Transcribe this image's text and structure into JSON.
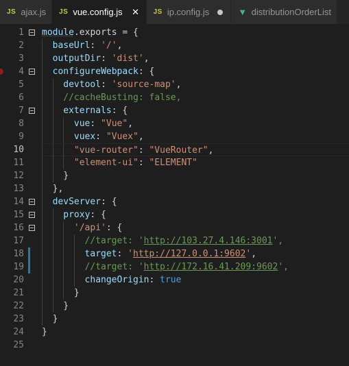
{
  "tabs": [
    {
      "type": "JS",
      "name": "ajax.js",
      "active": false,
      "state": "none"
    },
    {
      "type": "JS",
      "name": "vue.config.js",
      "active": true,
      "state": "close"
    },
    {
      "type": "JS",
      "name": "ip.config.js",
      "active": false,
      "state": "dirty"
    },
    {
      "type": "V",
      "name": "distributionOrderList",
      "active": false,
      "state": "none"
    }
  ],
  "close_glyph": "✕",
  "current_line": 10,
  "lines": [
    {
      "n": "1",
      "indent": 0,
      "fold": true,
      "tokens": [
        [
          "module",
          "var-under"
        ],
        [
          ".exports = {",
          "plain"
        ]
      ]
    },
    {
      "n": "2",
      "indent": 1,
      "tokens": [
        [
          "baseUrl",
          "var"
        ],
        [
          ": ",
          "plain"
        ],
        [
          "'/'",
          "str"
        ],
        [
          ",",
          "plain"
        ]
      ]
    },
    {
      "n": "3",
      "indent": 1,
      "tokens": [
        [
          "outputDir",
          "var"
        ],
        [
          ": ",
          "plain"
        ],
        [
          "'dist'",
          "str"
        ],
        [
          ",",
          "plain"
        ]
      ]
    },
    {
      "n": "4",
      "indent": 1,
      "fold": true,
      "breakpoint": true,
      "tokens": [
        [
          "configureWebpack",
          "var"
        ],
        [
          ": {",
          "plain"
        ]
      ]
    },
    {
      "n": "5",
      "indent": 2,
      "tokens": [
        [
          "devtool",
          "var"
        ],
        [
          ": ",
          "plain"
        ],
        [
          "'source-map'",
          "str"
        ],
        [
          ",",
          "plain"
        ]
      ]
    },
    {
      "n": "6",
      "indent": 2,
      "tokens": [
        [
          "//cacheBusting: false,",
          "com"
        ]
      ]
    },
    {
      "n": "7",
      "indent": 2,
      "fold": true,
      "tokens": [
        [
          "externals",
          "var"
        ],
        [
          ": {",
          "plain"
        ]
      ]
    },
    {
      "n": "8",
      "indent": 3,
      "tokens": [
        [
          "vue",
          "var"
        ],
        [
          ": ",
          "plain"
        ],
        [
          "\"Vue\"",
          "str"
        ],
        [
          ",",
          "plain"
        ]
      ]
    },
    {
      "n": "9",
      "indent": 3,
      "tokens": [
        [
          "vuex",
          "var"
        ],
        [
          ": ",
          "plain"
        ],
        [
          "\"Vuex\"",
          "str"
        ],
        [
          ",",
          "plain"
        ]
      ]
    },
    {
      "n": "10",
      "indent": 3,
      "tokens": [
        [
          "\"vue-router\"",
          "str"
        ],
        [
          ": ",
          "plain"
        ],
        [
          "\"VueRouter\"",
          "str"
        ],
        [
          ",",
          "plain"
        ]
      ]
    },
    {
      "n": "11",
      "indent": 3,
      "tokens": [
        [
          "\"element-ui\"",
          "str"
        ],
        [
          ": ",
          "plain"
        ],
        [
          "\"ELEMENT\"",
          "str"
        ]
      ]
    },
    {
      "n": "12",
      "indent": 2,
      "tokens": [
        [
          "}",
          "plain"
        ]
      ]
    },
    {
      "n": "13",
      "indent": 1,
      "tokens": [
        [
          "},",
          "plain"
        ]
      ]
    },
    {
      "n": "14",
      "indent": 1,
      "fold": true,
      "tokens": [
        [
          "devServer",
          "var"
        ],
        [
          ": {",
          "plain"
        ]
      ]
    },
    {
      "n": "15",
      "indent": 2,
      "fold": true,
      "tokens": [
        [
          "proxy",
          "var"
        ],
        [
          ": {",
          "plain"
        ]
      ]
    },
    {
      "n": "16",
      "indent": 3,
      "fold": true,
      "tokens": [
        [
          "'/api'",
          "str"
        ],
        [
          ": {",
          "plain"
        ]
      ]
    },
    {
      "n": "17",
      "indent": 4,
      "tokens": [
        [
          "//target: '",
          "com"
        ],
        [
          "http://103.27.4.146:3001",
          "com-url"
        ],
        [
          "',",
          "com"
        ]
      ]
    },
    {
      "n": "18",
      "indent": 4,
      "modified": true,
      "tokens": [
        [
          "target",
          "var"
        ],
        [
          ": ",
          "plain"
        ],
        [
          "'",
          "str"
        ],
        [
          "http://127.0.0.1:9602",
          "url"
        ],
        [
          "'",
          "str"
        ],
        [
          ",",
          "plain"
        ]
      ]
    },
    {
      "n": "19",
      "indent": 4,
      "modified": true,
      "tokens": [
        [
          "//target: '",
          "com"
        ],
        [
          "http://172.16.41.209:9602",
          "com-url"
        ],
        [
          "',",
          "com"
        ]
      ]
    },
    {
      "n": "20",
      "indent": 4,
      "tokens": [
        [
          "changeOrigin",
          "var"
        ],
        [
          ": ",
          "plain"
        ],
        [
          "true",
          "bool"
        ]
      ]
    },
    {
      "n": "21",
      "indent": 3,
      "tokens": [
        [
          "}",
          "plain"
        ]
      ]
    },
    {
      "n": "22",
      "indent": 2,
      "tokens": [
        [
          "}",
          "plain"
        ]
      ]
    },
    {
      "n": "23",
      "indent": 1,
      "tokens": [
        [
          "}",
          "plain"
        ]
      ]
    },
    {
      "n": "24",
      "indent": 0,
      "tokens": [
        [
          "}",
          "plain"
        ]
      ]
    },
    {
      "n": "25",
      "indent": 0,
      "tokens": []
    }
  ]
}
